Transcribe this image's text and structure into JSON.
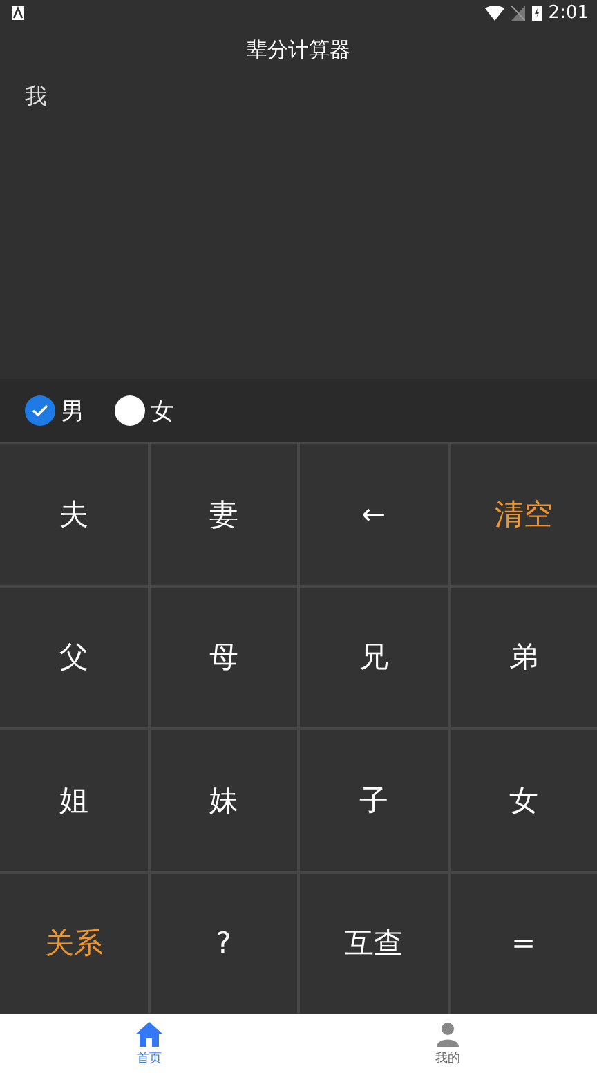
{
  "status_bar": {
    "time": "2:01"
  },
  "title": "辈分计算器",
  "display": {
    "text": "我"
  },
  "gender": [
    {
      "label": "男",
      "selected": true
    },
    {
      "label": "女",
      "selected": false
    }
  ],
  "keys": [
    {
      "label": "夫",
      "kind": "normal"
    },
    {
      "label": "妻",
      "kind": "normal"
    },
    {
      "label": "←",
      "kind": "normal"
    },
    {
      "label": "清空",
      "kind": "accent"
    },
    {
      "label": "父",
      "kind": "normal"
    },
    {
      "label": "母",
      "kind": "normal"
    },
    {
      "label": "兄",
      "kind": "normal"
    },
    {
      "label": "弟",
      "kind": "normal"
    },
    {
      "label": "姐",
      "kind": "normal"
    },
    {
      "label": "妹",
      "kind": "normal"
    },
    {
      "label": "子",
      "kind": "normal"
    },
    {
      "label": "女",
      "kind": "normal"
    },
    {
      "label": "关系",
      "kind": "accent"
    },
    {
      "label": "?",
      "kind": "normal"
    },
    {
      "label": "互查",
      "kind": "normal"
    },
    {
      "label": "=",
      "kind": "normal"
    }
  ],
  "nav": [
    {
      "label": "首页",
      "selected": true,
      "kind": "home"
    },
    {
      "label": "我的",
      "selected": false,
      "kind": "person"
    }
  ]
}
